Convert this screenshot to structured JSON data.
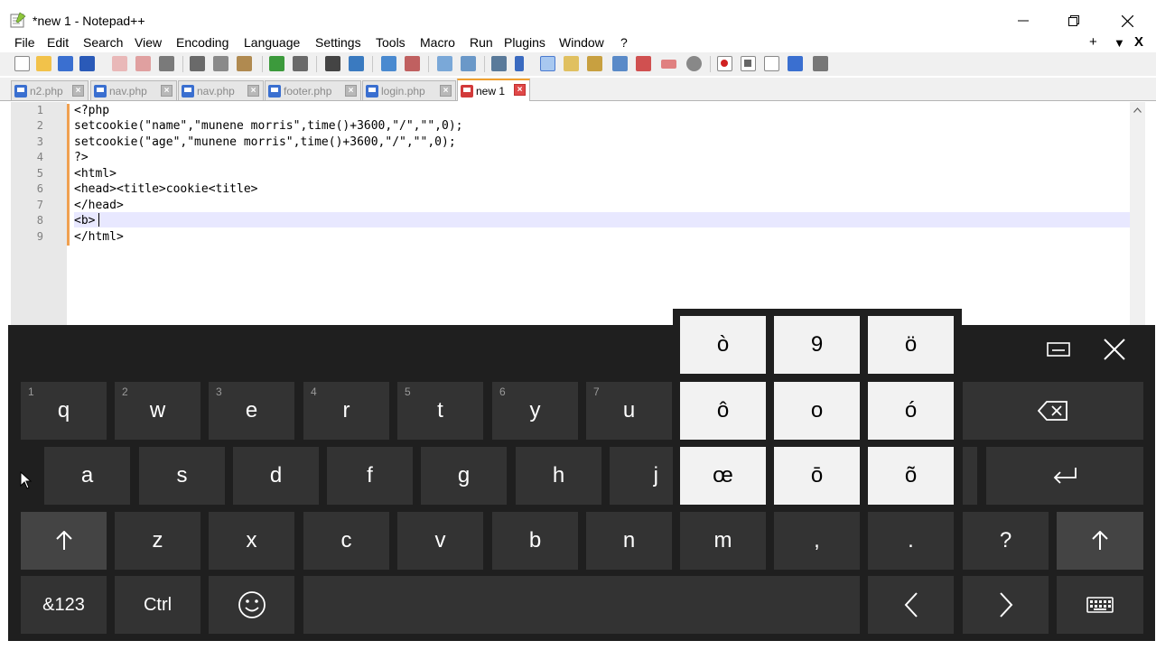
{
  "window": {
    "title": "*new 1 - Notepad++",
    "controls": [
      "minimize",
      "maximize",
      "close"
    ]
  },
  "menu": {
    "items": [
      "File",
      "Edit",
      "Search",
      "View",
      "Encoding",
      "Language",
      "Settings",
      "Tools",
      "Macro",
      "Run",
      "Plugins",
      "Window",
      "?"
    ],
    "right": [
      "+",
      "▼",
      "X"
    ]
  },
  "tabs": [
    {
      "label": "n2.php",
      "active": false
    },
    {
      "label": "nav.php",
      "active": false
    },
    {
      "label": "nav.php",
      "active": false
    },
    {
      "label": "footer.php",
      "active": false
    },
    {
      "label": "login.php",
      "active": false
    },
    {
      "label": "new 1",
      "active": true
    }
  ],
  "editor": {
    "line_numbers": [
      "1",
      "2",
      "3",
      "4",
      "5",
      "6",
      "7",
      "8",
      "9"
    ],
    "lines": [
      "<?php",
      "setcookie(\"name\",\"munene morris\",time()+3600,\"/\",\"\",0);",
      "setcookie(\"age\",\"munene morris\",time()+3600,\"/\",\"\",0);",
      "?>",
      "<html>",
      "<head><title>cookie<title>",
      "</head>",
      "<b>",
      "</html>"
    ],
    "current_line": 8
  },
  "keyboard": {
    "popup_keys": [
      "ò",
      "9",
      "ö",
      "ô",
      "o",
      "ó",
      "œ",
      "ō",
      "õ"
    ],
    "row1": [
      {
        "label": "q",
        "hint": "1"
      },
      {
        "label": "w",
        "hint": "2"
      },
      {
        "label": "e",
        "hint": "3"
      },
      {
        "label": "r",
        "hint": "4"
      },
      {
        "label": "t",
        "hint": "5"
      },
      {
        "label": "y",
        "hint": "6"
      },
      {
        "label": "u",
        "hint": "7"
      }
    ],
    "row2": [
      "a",
      "s",
      "d",
      "f",
      "g",
      "h",
      "j"
    ],
    "row3": [
      "z",
      "x",
      "c",
      "v",
      "b",
      "n",
      "m",
      ",",
      ".",
      "?"
    ],
    "row4": {
      "numbers": "&123",
      "ctrl": "Ctrl"
    },
    "icons": {
      "backspace": "backspace-icon",
      "enter": "enter-icon",
      "shift": "shift-icon",
      "emoji": "emoji-icon",
      "left": "arrow-left-icon",
      "right": "arrow-right-icon",
      "layout": "keyboard-icon",
      "dock": "dock-icon",
      "close": "close-icon"
    }
  },
  "colors": {
    "keyboard_bg": "#1f1f1f",
    "key_bg": "#333333",
    "popup_key_bg": "#f2f2f2",
    "accent": "#f0a030",
    "current_line": "#e8e8ff"
  }
}
